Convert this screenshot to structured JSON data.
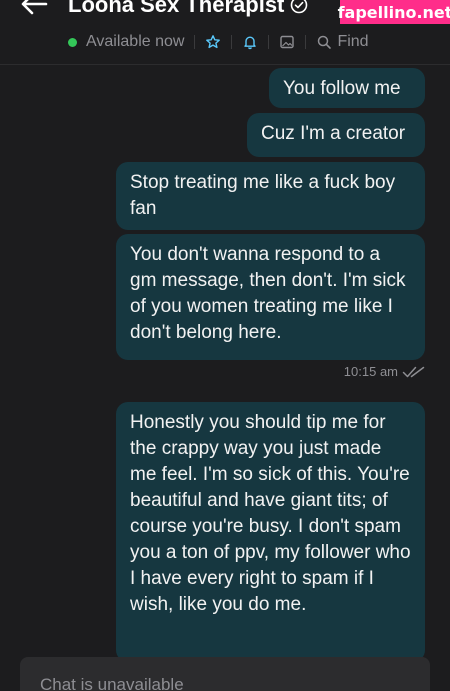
{
  "header": {
    "title": "Loona Sex Therapist",
    "status": "Available now",
    "find_label": "Find"
  },
  "watermark": "fapellino.net",
  "messages": [
    {
      "text": "You follow me"
    },
    {
      "text": "Cuz I'm a creator"
    },
    {
      "text": "Stop treating me like a fuck boy fan"
    },
    {
      "text": "You don't wanna respond to a gm message, then don't. I'm sick of you women treating me like I don't belong here."
    },
    {
      "text": "Honestly you should tip me for the crappy way you just made me feel. I'm so sick of this. You're beautiful and have giant tits; of course you're busy. I don't spam you a ton of ppv, my follower who I have every right to spam if I wish, like you do me."
    }
  ],
  "timestamp": "10:15 am",
  "composer": {
    "label": "Chat is unavailable"
  },
  "colors": {
    "background": "#1c1c1e",
    "bubble": "#163740",
    "online": "#34c759",
    "accent": "#5ac8fa",
    "watermark": "#ff2d8a"
  },
  "icons": [
    "back-arrow-icon",
    "verified-icon",
    "star-icon",
    "bell-icon",
    "image-icon",
    "search-icon",
    "double-check-icon"
  ]
}
